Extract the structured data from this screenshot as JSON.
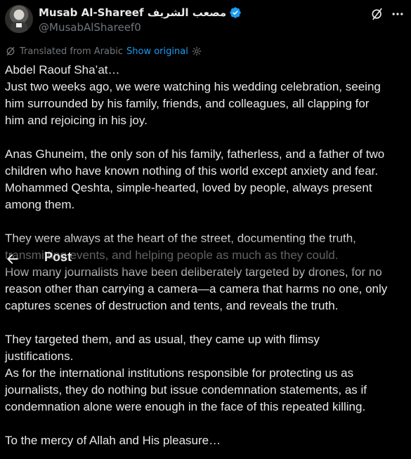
{
  "author": {
    "name": "Musab Al-Shareef مصعب الشريف",
    "handle": "@MusabAlShareef0"
  },
  "translation": {
    "label": "Translated from Arabic",
    "show_original": "Show original"
  },
  "tweet_lines": [
    "Abdel Raouf Sha’at…",
    "Just two weeks ago, we were watching his wedding celebration, seeing",
    "him surrounded by his family, friends, and colleagues, all clapping for",
    "him and rejoicing in his joy.",
    "",
    "Anas Ghuneim, the only son of his family, fatherless, and a father of two",
    "children who have known nothing of this world except anxiety and fear.",
    "Mohammed Qeshta, simple-hearted, loved by people, always present",
    "among them.",
    "",
    "They were always at the heart of the street, documenting the truth,",
    "transmitting events, and helping people as much as they could.",
    "How many journalists have been deliberately targeted by drones, for no",
    "reason other than carrying a camera—a camera that harms no one, only",
    "captures scenes of destruction and tents, and reveals the truth.",
    "",
    "They targeted them, and as usual, they came up with flimsy",
    "justifications.",
    "As for the international institutions responsible for protecting us as",
    "journalists, they do nothing but issue condemnation statements, as if",
    "condemnation alone were enough in the face of this repeated killing.",
    "",
    "To the mercy of Allah and His pleasure…"
  ],
  "nav": {
    "title": "Post"
  },
  "colors": {
    "background": "#000000",
    "text": "#e7e9ea",
    "secondary": "#71767b",
    "accent": "#1d9bf0"
  },
  "icons": {
    "verified": "verified-badge-icon",
    "grok": "grok-icon",
    "more": "more-icon",
    "translate": "translate-icon",
    "settings": "gear-icon",
    "back": "back-arrow-icon"
  }
}
